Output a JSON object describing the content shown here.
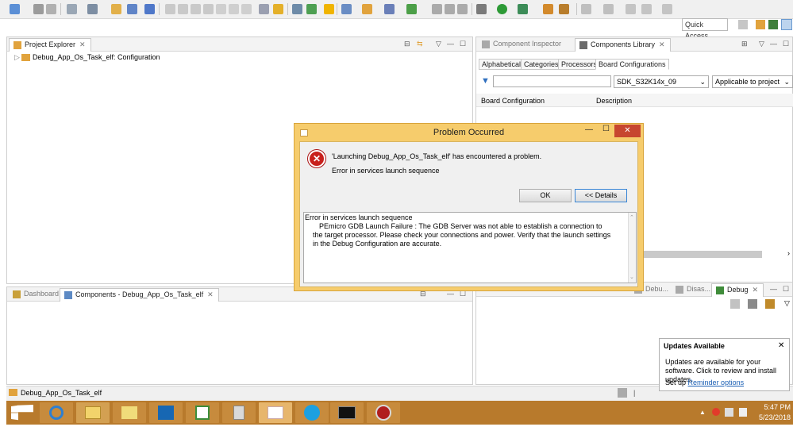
{
  "toolbar": {
    "quick_access_label": "Quick Access"
  },
  "project_explorer": {
    "tab_label": "Project Explorer",
    "tree": [
      {
        "label": "Debug_App_Os_Task_elf: Configuration"
      }
    ]
  },
  "component_panel": {
    "tabs": [
      {
        "label": "Component Inspector"
      },
      {
        "label": "Components Library"
      }
    ],
    "subtabs": [
      "Alphabetical",
      "Categories",
      "Processors",
      "Board Configurations"
    ],
    "filter_select": "SDK_S32K14x_09",
    "scope_select": "Applicable to project",
    "columns": [
      "Board Configuration",
      "Description"
    ]
  },
  "lower_left": {
    "tabs": [
      {
        "label": "Dashboard"
      },
      {
        "label": "Components - Debug_App_Os_Task_elf"
      }
    ]
  },
  "lower_right": {
    "tabs": [
      {
        "label": "Debu..."
      },
      {
        "label": "Disas..."
      },
      {
        "label": "Debug"
      }
    ]
  },
  "dialog": {
    "title": "Problem Occurred",
    "message": "'Launching Debug_App_Os_Task_elf' has encountered a problem.",
    "submessage": "Error in services launch sequence",
    "ok_label": "OK",
    "details_label": "<< Details",
    "details_heading": "Error in services launch sequence",
    "details_text": "PEmicro GDB Launch Failure : The GDB Server was not able to establish a connection to the target processor. Please check your connections and power. Verify that the launch settings in the Debug Configuration are accurate."
  },
  "statusbar": {
    "label": "Debug_App_Os_Task_elf"
  },
  "updates_popup": {
    "title": "Updates Available",
    "body": "Updates are available for your software. Click to review and install updates.",
    "setup_prefix": "Set up",
    "link": "Reminder options"
  },
  "taskbar": {
    "time": "5:47 PM",
    "date": "5/23/2018"
  }
}
